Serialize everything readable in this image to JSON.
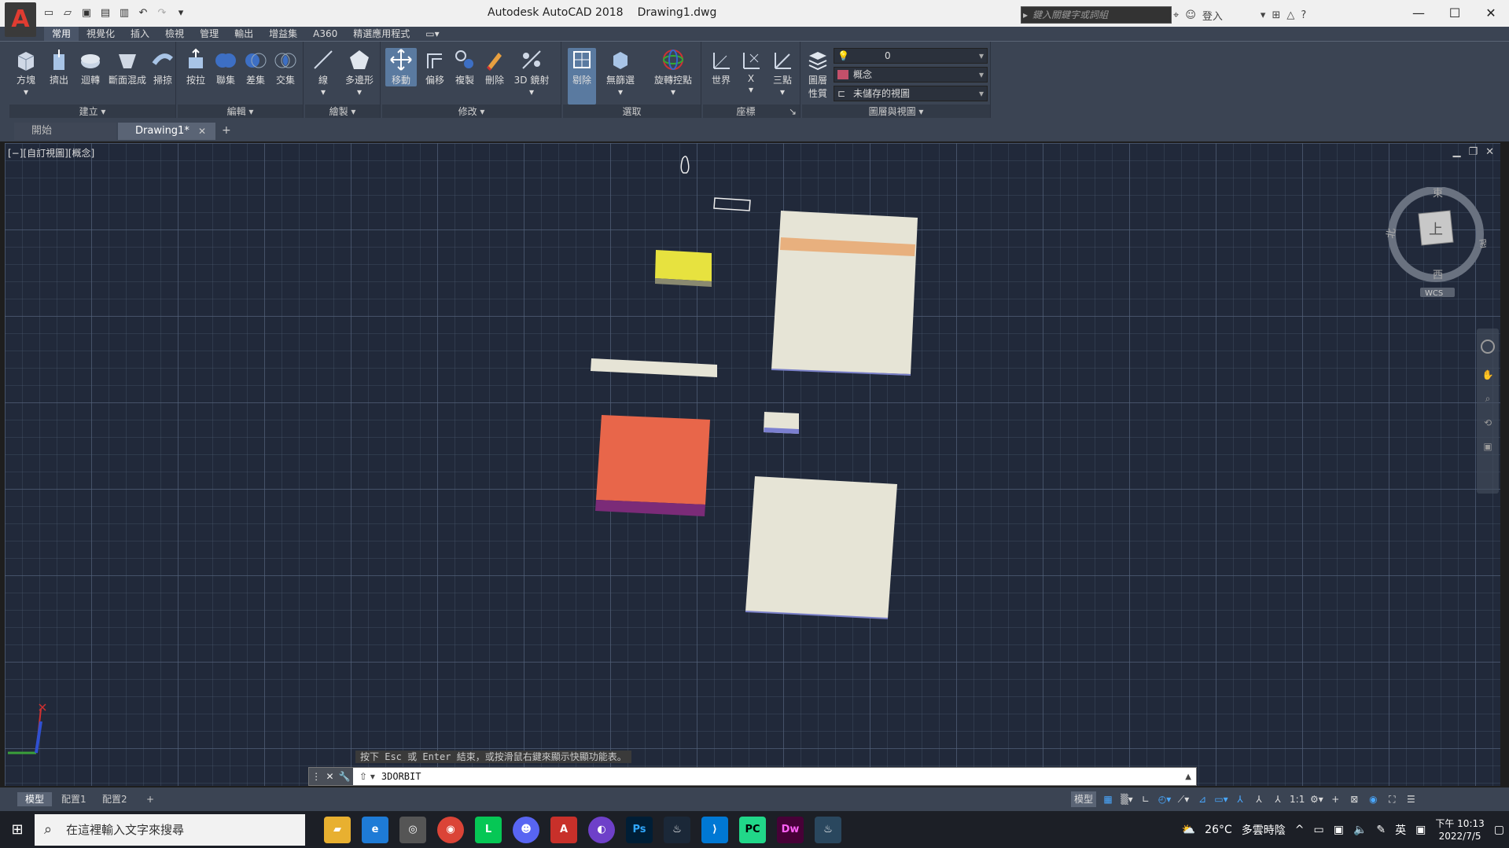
{
  "titlebar": {
    "app_name": "Autodesk AutoCAD 2018",
    "file_name": "Drawing1.dwg",
    "search_placeholder": "鍵入關鍵字或詞組",
    "signin": "登入",
    "logo": "A"
  },
  "ribbon_tabs": [
    "常用",
    "視覺化",
    "插入",
    "檢視",
    "管理",
    "輸出",
    "增益集",
    "A360",
    "精選應用程式"
  ],
  "ribbon": {
    "groups": {
      "create": "建立",
      "edit": "編輯",
      "draw": "繪製",
      "modify": "修改",
      "selection": "選取",
      "coordinates": "座標",
      "layers_views": "圖層與視圖"
    },
    "buttons": {
      "box": "方塊",
      "extrude": "擠出",
      "revolve": "迴轉",
      "loft": "斷面混成",
      "sweep": "掃掠",
      "presspull": "按拉",
      "union": "聯集",
      "subtract": "差集",
      "intersect": "交集",
      "line": "線",
      "polygon": "多邊形",
      "move": "移動",
      "offset": "偏移",
      "copy": "複製",
      "erase": "刪除",
      "mirror3d": "3D 鏡射",
      "cull": "剔除",
      "no_filter": "無篩選",
      "gizmo": "旋轉控點",
      "world": "世界",
      "x_axis": "X",
      "three_point": "三點",
      "layer_props": "圖層\n性質"
    },
    "layer_dropdown": "0",
    "visual_style": "概念",
    "view_dropdown": "未儲存的視圖"
  },
  "file_tabs": {
    "start": "開始",
    "drawing": "Drawing1*"
  },
  "viewport": {
    "label": "[−][自訂視圖][概念]",
    "viewcube_face": "上",
    "dir_north": "北",
    "dir_east": "東",
    "dir_south": "南",
    "dir_west": "西",
    "wcs": "WCS"
  },
  "command": {
    "hint": "按下 Esc 或 Enter 結束，或按滑鼠右鍵來顯示快顯功能表。",
    "value": "3DORBIT"
  },
  "layout_tabs": [
    "模型",
    "配置1",
    "配置2"
  ],
  "status": {
    "model": "模型",
    "scale": "1:1"
  },
  "taskbar": {
    "search_placeholder": "在這裡輸入文字來搜尋",
    "weather_temp": "26°C",
    "weather_desc": "多雲時陰",
    "ime": "英",
    "time": "下午 10:13",
    "date": "2022/7/5"
  },
  "colors": {
    "yellow_block": "#e7e23f",
    "orange_block": "#e8664a",
    "purple_band": "#7b2b78",
    "cream": "#e6e4d6",
    "peach_band": "#e8b07e"
  }
}
